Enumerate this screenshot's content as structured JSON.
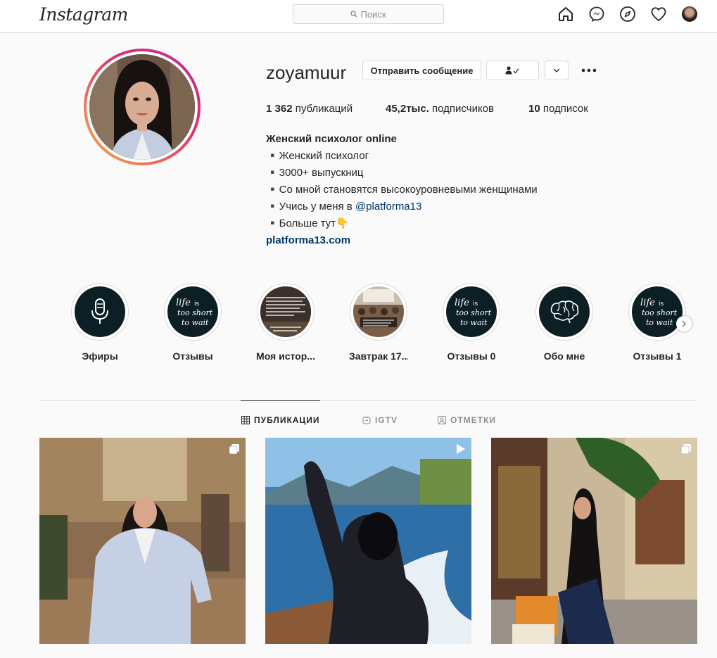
{
  "header": {
    "logo": "Instagram",
    "search_placeholder": "Поиск"
  },
  "profile": {
    "username": "zoyamuur",
    "message_button": "Отправить сообщение",
    "stats": {
      "posts_count": "1 362",
      "posts_label": "публикаций",
      "followers_count": "45,2тыс.",
      "followers_label": "подписчиков",
      "following_count": "10",
      "following_label": "подписок"
    },
    "bio": {
      "name": "Женский психолог online",
      "line1": "▪️Женский психолог",
      "line2": "▪️3000+ выпускниц",
      "line3": "▪️Со мной становятся высокоуровневыми женщинами",
      "line4_prefix": "▪️Учись у меня в ",
      "line4_mention": "@platforma13",
      "line5": "▪️Больше тут👇",
      "website": "platforma13.com"
    }
  },
  "highlights": [
    {
      "label": "Эфиры",
      "icon": "microphone-icon"
    },
    {
      "label": "Отзывы",
      "icon": "life-is-too-short-lettering"
    },
    {
      "label": "Моя истор...",
      "icon": "text-story"
    },
    {
      "label": "Завтрак 17....",
      "icon": "event-photo"
    },
    {
      "label": "Отзывы 0",
      "icon": "life-is-too-short-lettering"
    },
    {
      "label": "Обо мне",
      "icon": "brain-icon"
    },
    {
      "label": "Отзывы 1",
      "icon": "life-is-too-short-lettering"
    }
  ],
  "highlight_lettering": "life is too short to wait",
  "tabs": {
    "posts": "ПУБЛИКАЦИИ",
    "igtv": "IGTV",
    "tagged": "ОТМЕТКИ"
  },
  "posts": [
    {
      "type": "carousel",
      "icon": "multiple-posts-icon"
    },
    {
      "type": "video",
      "icon": "video-icon"
    },
    {
      "type": "carousel",
      "icon": "multiple-posts-icon"
    }
  ]
}
